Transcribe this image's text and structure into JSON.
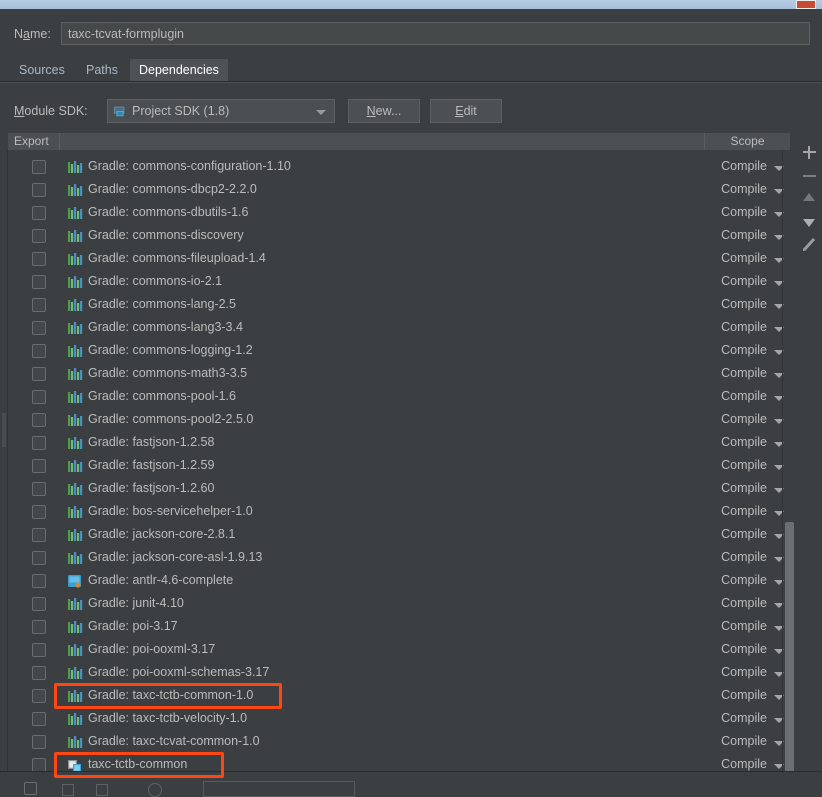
{
  "window": {
    "close_button": "close-button"
  },
  "name_field": {
    "label": "Name:",
    "value": "taxc-tcvat-formplugin"
  },
  "tabs": [
    {
      "label": "Sources",
      "active": false
    },
    {
      "label": "Paths",
      "active": false
    },
    {
      "label": "Dependencies",
      "active": true
    }
  ],
  "sdk_row": {
    "label": "Module SDK:",
    "selected": "Project SDK (1.8)",
    "new_button": "New...",
    "edit_button": "Edit"
  },
  "table": {
    "headers": {
      "export": "Export",
      "name": "",
      "scope": "Scope"
    }
  },
  "dependencies": [
    {
      "name": "Gradle: commons-configuration-1.10",
      "scope": "Compile",
      "icon": "library-icon",
      "checked": false,
      "highlighted": false
    },
    {
      "name": "Gradle: commons-dbcp2-2.2.0",
      "scope": "Compile",
      "icon": "library-icon",
      "checked": false,
      "highlighted": false
    },
    {
      "name": "Gradle: commons-dbutils-1.6",
      "scope": "Compile",
      "icon": "library-icon",
      "checked": false,
      "highlighted": false
    },
    {
      "name": "Gradle: commons-discovery",
      "scope": "Compile",
      "icon": "library-icon",
      "checked": false,
      "highlighted": false
    },
    {
      "name": "Gradle: commons-fileupload-1.4",
      "scope": "Compile",
      "icon": "library-icon",
      "checked": false,
      "highlighted": false
    },
    {
      "name": "Gradle: commons-io-2.1",
      "scope": "Compile",
      "icon": "library-icon",
      "checked": false,
      "highlighted": false
    },
    {
      "name": "Gradle: commons-lang-2.5",
      "scope": "Compile",
      "icon": "library-icon",
      "checked": false,
      "highlighted": false
    },
    {
      "name": "Gradle: commons-lang3-3.4",
      "scope": "Compile",
      "icon": "library-icon",
      "checked": false,
      "highlighted": false
    },
    {
      "name": "Gradle: commons-logging-1.2",
      "scope": "Compile",
      "icon": "library-icon",
      "checked": false,
      "highlighted": false
    },
    {
      "name": "Gradle: commons-math3-3.5",
      "scope": "Compile",
      "icon": "library-icon",
      "checked": false,
      "highlighted": false
    },
    {
      "name": "Gradle: commons-pool-1.6",
      "scope": "Compile",
      "icon": "library-icon",
      "checked": false,
      "highlighted": false
    },
    {
      "name": "Gradle: commons-pool2-2.5.0",
      "scope": "Compile",
      "icon": "library-icon",
      "checked": false,
      "highlighted": false
    },
    {
      "name": "Gradle: fastjson-1.2.58",
      "scope": "Compile",
      "icon": "library-icon",
      "checked": false,
      "highlighted": false
    },
    {
      "name": "Gradle: fastjson-1.2.59",
      "scope": "Compile",
      "icon": "library-icon",
      "checked": false,
      "highlighted": false
    },
    {
      "name": "Gradle: fastjson-1.2.60",
      "scope": "Compile",
      "icon": "library-icon",
      "checked": false,
      "highlighted": false
    },
    {
      "name": "Gradle: bos-servicehelper-1.0",
      "scope": "Compile",
      "icon": "library-icon",
      "checked": false,
      "highlighted": false
    },
    {
      "name": "Gradle: jackson-core-2.8.1",
      "scope": "Compile",
      "icon": "library-icon",
      "checked": false,
      "highlighted": false
    },
    {
      "name": "Gradle: jackson-core-asl-1.9.13",
      "scope": "Compile",
      "icon": "library-icon",
      "checked": false,
      "highlighted": false
    },
    {
      "name": "Gradle: antlr-4.6-complete",
      "scope": "Compile",
      "icon": "jar-icon",
      "checked": false,
      "highlighted": false
    },
    {
      "name": "Gradle: junit-4.10",
      "scope": "Compile",
      "icon": "library-icon",
      "checked": false,
      "highlighted": false
    },
    {
      "name": "Gradle: poi-3.17",
      "scope": "Compile",
      "icon": "library-icon",
      "checked": false,
      "highlighted": false
    },
    {
      "name": "Gradle: poi-ooxml-3.17",
      "scope": "Compile",
      "icon": "library-icon",
      "checked": false,
      "highlighted": false
    },
    {
      "name": "Gradle: poi-ooxml-schemas-3.17",
      "scope": "Compile",
      "icon": "library-icon",
      "checked": false,
      "highlighted": false
    },
    {
      "name": "Gradle: taxc-tctb-common-1.0",
      "scope": "Compile",
      "icon": "library-icon",
      "checked": false,
      "highlighted": true
    },
    {
      "name": "Gradle: taxc-tctb-velocity-1.0",
      "scope": "Compile",
      "icon": "library-icon",
      "checked": false,
      "highlighted": false
    },
    {
      "name": "Gradle: taxc-tcvat-common-1.0",
      "scope": "Compile",
      "icon": "library-icon",
      "checked": false,
      "highlighted": false
    },
    {
      "name": "taxc-tctb-common",
      "scope": "Compile",
      "icon": "module-icon",
      "checked": false,
      "highlighted": true
    }
  ],
  "side_toolbar": [
    {
      "icon": "plus-icon",
      "label": "Add"
    },
    {
      "icon": "minus-icon",
      "label": "Remove"
    },
    {
      "icon": "arrow-up-icon",
      "label": "Move Up"
    },
    {
      "icon": "arrow-down-icon",
      "label": "Move Down"
    },
    {
      "icon": "edit-pencil-icon",
      "label": "Edit"
    }
  ],
  "colors": {
    "background": "#3c3f41",
    "panel": "#45494a",
    "text": "#bbbbbb",
    "highlight": "#ff4713",
    "accent_tab": "#4e5254",
    "titlebar": "#b8cde3"
  }
}
